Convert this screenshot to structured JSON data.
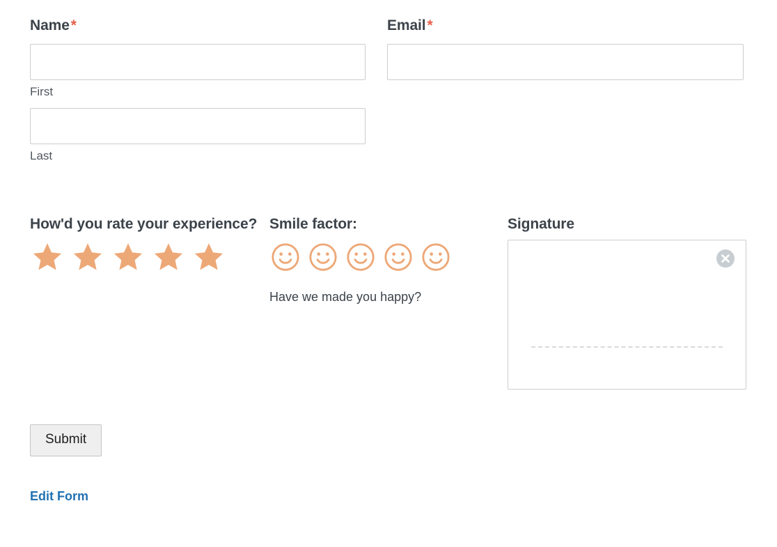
{
  "colors": {
    "accent_orange": "#eda877",
    "required_asterisk": "#e8604c",
    "link_blue": "#2271b1",
    "label_text": "#3c434a",
    "input_border": "#cdcdcd",
    "signature_line": "#d8dadc",
    "clear_button": "#c7cdd1",
    "submit_background": "#efefef"
  },
  "fields": {
    "name": {
      "label": "Name",
      "required_marker": "*",
      "first": {
        "value": "",
        "placeholder": "",
        "sub_label": "First"
      },
      "last": {
        "value": "",
        "placeholder": "",
        "sub_label": "Last"
      }
    },
    "email": {
      "label": "Email",
      "required_marker": "*",
      "value": "",
      "placeholder": ""
    },
    "rating": {
      "label": "How'd you rate your experience?",
      "icon": "star-icon",
      "max": 5,
      "selected": 5,
      "stars": [
        1,
        2,
        3,
        4,
        5
      ]
    },
    "smile": {
      "label": "Smile factor:",
      "icon": "smiley-face-icon",
      "max": 5,
      "selected": 0,
      "faces": [
        1,
        2,
        3,
        4,
        5
      ],
      "description": "Have we made you happy?"
    },
    "signature": {
      "label": "Signature",
      "value": "",
      "clear_icon": "clear-circle-x-icon",
      "clear_title": "Clear"
    }
  },
  "actions": {
    "submit_label": "Submit",
    "edit_form_label": "Edit Form"
  }
}
